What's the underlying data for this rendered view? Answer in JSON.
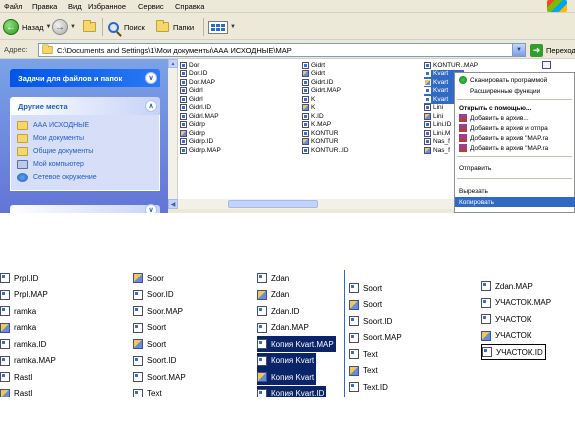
{
  "menubar": {
    "items": [
      "Файл",
      "Правка",
      "Вид",
      "Избранное",
      "Сервис",
      "Справка"
    ]
  },
  "toolbar": {
    "back": "Назад",
    "search": "Поиск",
    "folders": "Папки"
  },
  "address": {
    "label": "Адрес:",
    "path": "C:\\Documents and Settings\\1\\Мои документы\\ААА ИСХОДНЫЕ\\MAP",
    "go": "Переход"
  },
  "taskpane": {
    "tasks_title": "Задачи для файлов и папок",
    "places_title": "Другие места",
    "places": [
      "ААА ИСХОДНЫЕ",
      "Мои документы",
      "Общие документы",
      "Мой компьютер",
      "Сетевое окружение"
    ]
  },
  "files": {
    "col1": [
      {
        "name": "Dor",
        "icon": "map-file",
        "sel": false
      },
      {
        "name": "Dor.ID",
        "icon": "map-file",
        "sel": false
      },
      {
        "name": "Dor.MAP",
        "icon": "map-file",
        "sel": false
      },
      {
        "name": "Gidrl",
        "icon": "map-file",
        "sel": false
      },
      {
        "name": "Gidrl",
        "icon": "map-file",
        "sel": false
      },
      {
        "name": "Gidrl.ID",
        "icon": "map-file",
        "sel": false
      },
      {
        "name": "Gidrl.MAP",
        "icon": "map-file",
        "sel": false
      },
      {
        "name": "Gidrp",
        "icon": "map-file",
        "sel": false
      },
      {
        "name": "Gidrp",
        "icon": "color-file",
        "sel": false
      },
      {
        "name": "Gidrp.ID",
        "icon": "map-file",
        "sel": false
      },
      {
        "name": "Gidrp.MAP",
        "icon": "map-file",
        "sel": false
      }
    ],
    "col2": [
      {
        "name": "Gidrt",
        "icon": "map-file",
        "sel": false
      },
      {
        "name": "Gidrt",
        "icon": "color-file",
        "sel": false
      },
      {
        "name": "Gidrt.ID",
        "icon": "map-file",
        "sel": false
      },
      {
        "name": "Gidrt.MAP",
        "icon": "map-file",
        "sel": false
      },
      {
        "name": "K",
        "icon": "map-file",
        "sel": false
      },
      {
        "name": "K",
        "icon": "color-file",
        "sel": false
      },
      {
        "name": "K.ID",
        "icon": "map-file",
        "sel": false
      },
      {
        "name": "K.MAP",
        "icon": "map-file",
        "sel": false
      },
      {
        "name": "KONTUR",
        "icon": "map-file",
        "sel": false
      },
      {
        "name": "KONTUR",
        "icon": "color-file",
        "sel": false
      },
      {
        "name": "KONTUR..ID",
        "icon": "map-file",
        "sel": false
      }
    ],
    "col3": [
      {
        "name": "KONTUR..MAP",
        "icon": "map-file",
        "sel": false
      },
      {
        "name": "Kvart",
        "icon": "map-file",
        "sel": true
      },
      {
        "name": "Kvart",
        "icon": "color-file",
        "sel": true
      },
      {
        "name": "Kvart",
        "icon": "map-file",
        "sel": true
      },
      {
        "name": "Kvart",
        "icon": "map-file",
        "sel": true
      },
      {
        "name": "Lini",
        "icon": "map-file",
        "sel": false
      },
      {
        "name": "Lini",
        "icon": "color-file",
        "sel": false
      },
      {
        "name": "Lini.ID",
        "icon": "map-file",
        "sel": false
      },
      {
        "name": "Lini.M",
        "icon": "map-file",
        "sel": false
      },
      {
        "name": "Nas_f",
        "icon": "map-file",
        "sel": false
      },
      {
        "name": "Nas_f",
        "icon": "color-file",
        "sel": false
      }
    ]
  },
  "context_menu": {
    "scan": "Сканировать программой",
    "advanced": "Расширенные функции",
    "open_with": "Открыть с помощью...",
    "add_archive": "Добавить в архив...",
    "add_send": "Добавить в архив и отпра",
    "add_map": "Добавить в архив \"MAP.ra",
    "add_map2": "Добавить в архив \"MAP.ra",
    "send_to": "Отправить",
    "cut": "Вырезать",
    "copy": "Копировать"
  },
  "bottom": {
    "p1": [
      {
        "name": "Prpl.ID",
        "icon": "map-file"
      },
      {
        "name": "Prpl.MAP",
        "icon": "map-file"
      },
      {
        "name": "ramka",
        "icon": "map-file"
      },
      {
        "name": "ramka",
        "icon": "color-file"
      },
      {
        "name": "ramka.ID",
        "icon": "map-file"
      },
      {
        "name": "ramka.MAP",
        "icon": "map-file"
      },
      {
        "name": "Rastl",
        "icon": "map-file"
      },
      {
        "name": "Rastl",
        "icon": "color-file"
      }
    ],
    "p2": [
      {
        "name": "Soor",
        "icon": "color-file"
      },
      {
        "name": "Soor.ID",
        "icon": "map-file"
      },
      {
        "name": "Soor.MAP",
        "icon": "map-file"
      },
      {
        "name": "Soort",
        "icon": "map-file"
      },
      {
        "name": "Soort",
        "icon": "color-file"
      },
      {
        "name": "Soort.ID",
        "icon": "map-file"
      },
      {
        "name": "Soort.MAP",
        "icon": "map-file"
      },
      {
        "name": "Text",
        "icon": "map-file"
      }
    ],
    "p3": [
      {
        "name": "Zdan",
        "icon": "map-file",
        "sel": false
      },
      {
        "name": "Zdan",
        "icon": "color-file",
        "sel": false
      },
      {
        "name": "Zdan.ID",
        "icon": "map-file",
        "sel": false
      },
      {
        "name": "Zdan.MAP",
        "icon": "map-file",
        "sel": false
      },
      {
        "name": "Копия Kvart.MAP",
        "icon": "map-file",
        "sel": true
      },
      {
        "name": "Копия Kvart",
        "icon": "map-file",
        "sel": true
      },
      {
        "name": "Копия Kvart",
        "icon": "color-file",
        "sel": true
      },
      {
        "name": "Копия Kvart.ID",
        "icon": "map-file",
        "sel": true
      }
    ],
    "p4": [
      {
        "name": "Soort",
        "icon": "map-file"
      },
      {
        "name": "Soort",
        "icon": "color-file"
      },
      {
        "name": "Soort.ID",
        "icon": "map-file"
      },
      {
        "name": "Soort.MAP",
        "icon": "map-file"
      },
      {
        "name": "Text",
        "icon": "map-file"
      },
      {
        "name": "Text",
        "icon": "color-file"
      },
      {
        "name": "Text.ID",
        "icon": "map-file"
      }
    ],
    "p5": [
      {
        "name": "Zdan.MAP",
        "icon": "map-file",
        "boxed": false
      },
      {
        "name": "УЧАСТОК.MAP",
        "icon": "map-file",
        "boxed": false
      },
      {
        "name": "УЧАСТОК",
        "icon": "map-file",
        "boxed": false
      },
      {
        "name": "УЧАСТОК",
        "icon": "color-file",
        "boxed": false
      },
      {
        "name": "УЧАСТОК.ID",
        "icon": "map-file",
        "boxed": true
      }
    ]
  }
}
